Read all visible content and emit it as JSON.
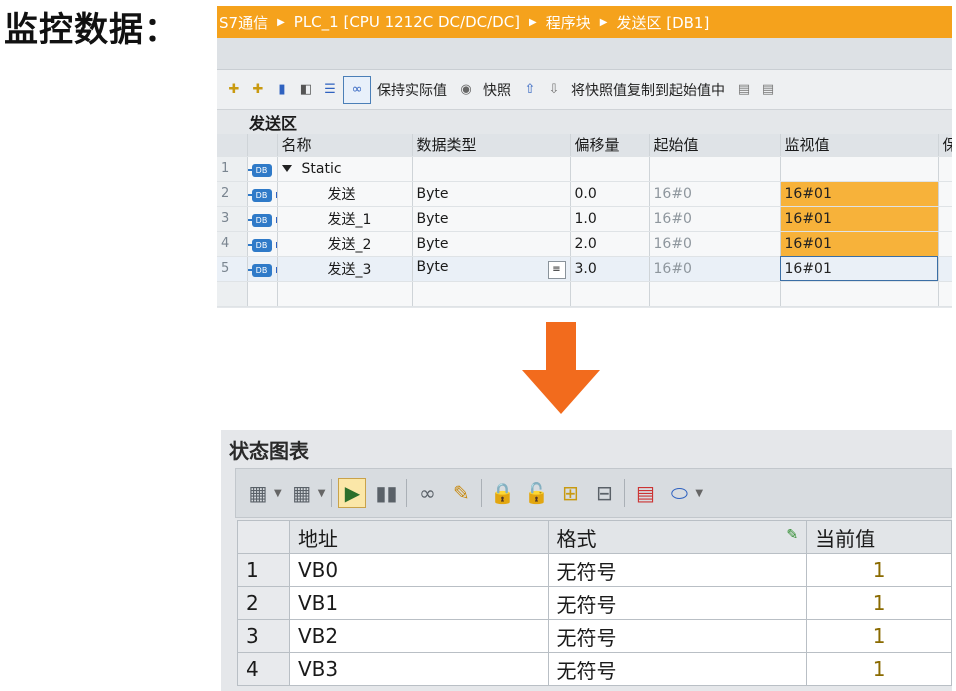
{
  "heading": "监控数据：",
  "tia": {
    "breadcrumb": [
      "S7通信",
      "PLC_1 [CPU 1212C DC/DC/DC]",
      "程序块",
      "发送区 [DB1]"
    ],
    "toolbar": {
      "keep_actual": "保持实际值",
      "snapshot": "快照",
      "copy_snapshot": "将快照值复制到起始值中"
    },
    "block_title": "发送区",
    "columns": [
      "名称",
      "数据类型",
      "偏移量",
      "起始值",
      "监视值",
      "保"
    ],
    "rows": [
      {
        "num": "1",
        "name": "Static",
        "type": "",
        "offset": "",
        "start": "",
        "watch": ""
      },
      {
        "num": "2",
        "name": "发送",
        "type": "Byte",
        "offset": "0.0",
        "start": "16#0",
        "watch": "16#01"
      },
      {
        "num": "3",
        "name": "发送_1",
        "type": "Byte",
        "offset": "1.0",
        "start": "16#0",
        "watch": "16#01"
      },
      {
        "num": "4",
        "name": "发送_2",
        "type": "Byte",
        "offset": "2.0",
        "start": "16#0",
        "watch": "16#01"
      },
      {
        "num": "5",
        "name": "发送_3",
        "type": "Byte",
        "offset": "3.0",
        "start": "16#0",
        "watch": "16#01"
      }
    ]
  },
  "status_chart": {
    "title": "状态图表",
    "columns": [
      "地址",
      "格式",
      "当前值"
    ],
    "rows": [
      {
        "num": "1",
        "address": "VB0",
        "format": "无符号",
        "value": "1"
      },
      {
        "num": "2",
        "address": "VB1",
        "format": "无符号",
        "value": "1"
      },
      {
        "num": "3",
        "address": "VB2",
        "format": "无符号",
        "value": "1"
      },
      {
        "num": "4",
        "address": "VB3",
        "format": "无符号",
        "value": "1"
      }
    ]
  },
  "colors": {
    "accent_orange": "#f5a21c",
    "watch_cell": "#f7b23a",
    "arrow": "#f26b1d"
  }
}
